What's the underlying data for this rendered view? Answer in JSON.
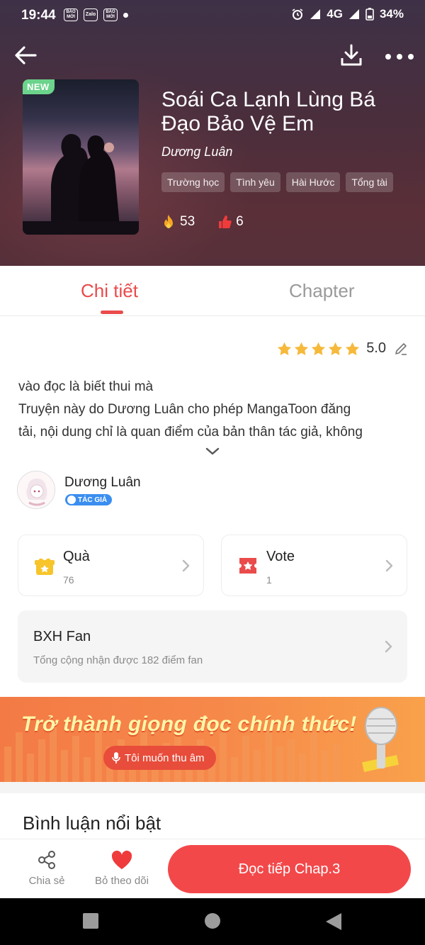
{
  "status_bar": {
    "time": "19:44",
    "network": "4G",
    "battery": "34%",
    "app_icons": [
      {
        "name": "baomoi-icon",
        "text": "BÁO MỚI"
      },
      {
        "name": "zalo-icon",
        "text": "Zalo"
      },
      {
        "name": "baomoi-icon-2",
        "text": "BÁO MỚI"
      }
    ]
  },
  "book": {
    "badge": "NEW",
    "title": "Soái Ca Lạnh Lùng Bá Đạo Bảo Vệ Em",
    "author": "Dương Luân",
    "tags": [
      "Trường học",
      "Tình yêu",
      "Hài Hước",
      "Tổng tài"
    ],
    "hot_count": "53",
    "like_count": "6"
  },
  "tabs": {
    "detail": "Chi tiết",
    "chapter": "Chapter",
    "active": "detail"
  },
  "rating": {
    "value": "5.0",
    "stars": 5
  },
  "description": {
    "line1": "vào đọc là biết thui mà",
    "line2": "Truyện này do Dương Luân cho phép MangaToon đăng",
    "line3": "tải, nội dung chỉ là quan điểm của bản thân tác giả, không"
  },
  "author_row": {
    "name": "Dương Luân",
    "badge": "TÁC GIẢ"
  },
  "cards": {
    "gift_title": "Quà",
    "gift_count": "76",
    "vote_title": "Vote",
    "vote_count": "1"
  },
  "fan": {
    "title": "BXH Fan",
    "subtitle": "Tổng cộng nhận được 182 điểm fan"
  },
  "banner": {
    "title": "Trở thành giọng đọc chính thức!",
    "button": "Tôi muốn thu âm"
  },
  "comments": {
    "title": "Bình luận nổi bật"
  },
  "actions": {
    "share": "Chia sẻ",
    "unfollow": "Bỏ theo dõi",
    "read": "Đọc tiếp Chap.3"
  },
  "colors": {
    "accent": "#ea4b4b",
    "read_button": "#f3484a",
    "new_badge": "#6bd38b",
    "star": "#f6b93b",
    "gift": "#f7c52b"
  }
}
